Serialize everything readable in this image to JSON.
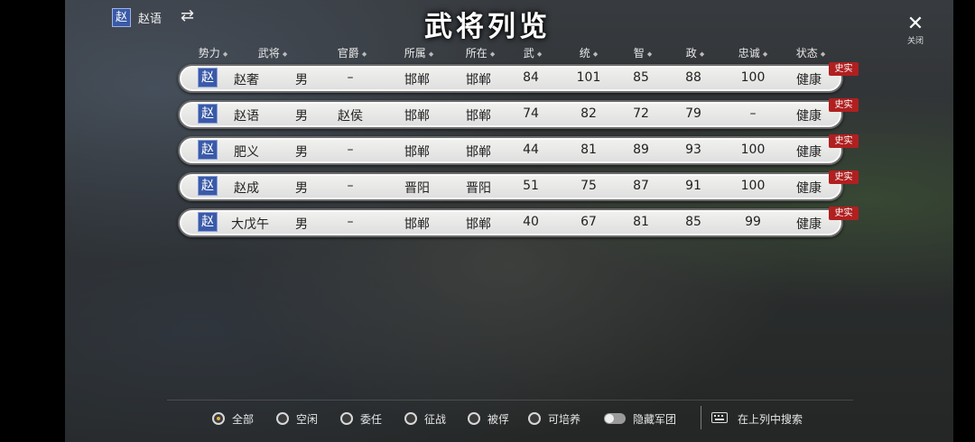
{
  "header": {
    "faction_chip": "赵",
    "faction_name": "赵语",
    "swap_icon": "⇄",
    "title": "武将列览",
    "close_label": "关闭"
  },
  "columns": [
    "势力",
    "武将",
    "官爵",
    "所属",
    "所在",
    "武",
    "统",
    "智",
    "政",
    "忠诚",
    "状态"
  ],
  "rows": [
    {
      "faction": "赵",
      "name": "赵奢",
      "gender": "男",
      "rank": "–",
      "belong": "邯郸",
      "location": "邯郸",
      "war": "84",
      "lead": "101",
      "int": "85",
      "pol": "88",
      "loyalty": "100",
      "status": "健康",
      "tag": "史实"
    },
    {
      "faction": "赵",
      "name": "赵语",
      "gender": "男",
      "rank": "赵侯",
      "belong": "邯郸",
      "location": "邯郸",
      "war": "74",
      "lead": "82",
      "int": "72",
      "pol": "79",
      "loyalty": "–",
      "status": "健康",
      "tag": "史实"
    },
    {
      "faction": "赵",
      "name": "肥义",
      "gender": "男",
      "rank": "–",
      "belong": "邯郸",
      "location": "邯郸",
      "war": "44",
      "lead": "81",
      "int": "89",
      "pol": "93",
      "loyalty": "100",
      "status": "健康",
      "tag": "史实"
    },
    {
      "faction": "赵",
      "name": "赵成",
      "gender": "男",
      "rank": "–",
      "belong": "晋阳",
      "location": "晋阳",
      "war": "51",
      "lead": "75",
      "int": "87",
      "pol": "91",
      "loyalty": "100",
      "status": "健康",
      "tag": "史实"
    },
    {
      "faction": "赵",
      "name": "大戊午",
      "gender": "男",
      "rank": "–",
      "belong": "邯郸",
      "location": "邯郸",
      "war": "40",
      "lead": "67",
      "int": "81",
      "pol": "85",
      "loyalty": "99",
      "status": "健康",
      "tag": "史实"
    }
  ],
  "filters": {
    "all": "全部",
    "idle": "空闲",
    "appointed": "委任",
    "campaign": "征战",
    "captured": "被俘",
    "trainable": "可培养",
    "hide_army": "隐藏军团",
    "selected": "all"
  },
  "search_label": "在上列中搜索",
  "colors": {
    "faction_blue": "#3a5aa8",
    "tag_red": "#b02020"
  }
}
